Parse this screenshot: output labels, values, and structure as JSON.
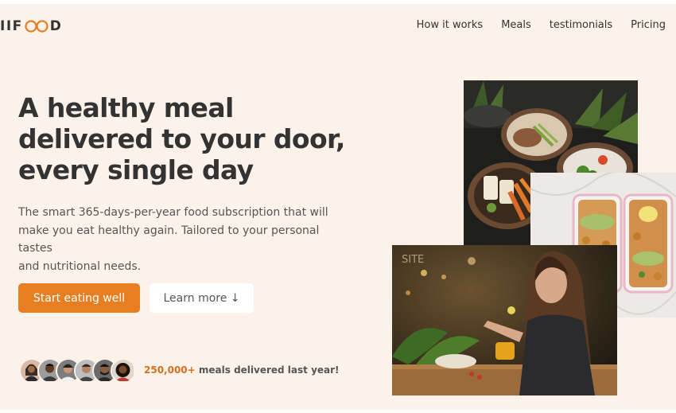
{
  "header": {
    "logo_text_left": "IIF",
    "logo_text_right": "D",
    "nav": [
      "How it works",
      "Meals",
      "testimonials",
      "Pricing"
    ]
  },
  "hero": {
    "title_lines": [
      "A healthy meal",
      "delivered to your door,",
      "every single day"
    ],
    "description_lines": [
      "The smart 365-days-per-year food subscription that will",
      "make you eat healthy again. Tailored to your personal tastes",
      "and nutritional needs."
    ],
    "primary_button": "Start eating well",
    "secondary_button": "Learn more ↓",
    "delivered_count": "250,000+",
    "delivered_text": " meals delivered last year!"
  },
  "images": {
    "bowls": "meal-bowls-photo",
    "prep": "meal-prep-containers-photo",
    "woman": "woman-eating-photo"
  },
  "colors": {
    "background": "#fdf2e9",
    "accent": "#e67e22",
    "text": "#333333"
  }
}
